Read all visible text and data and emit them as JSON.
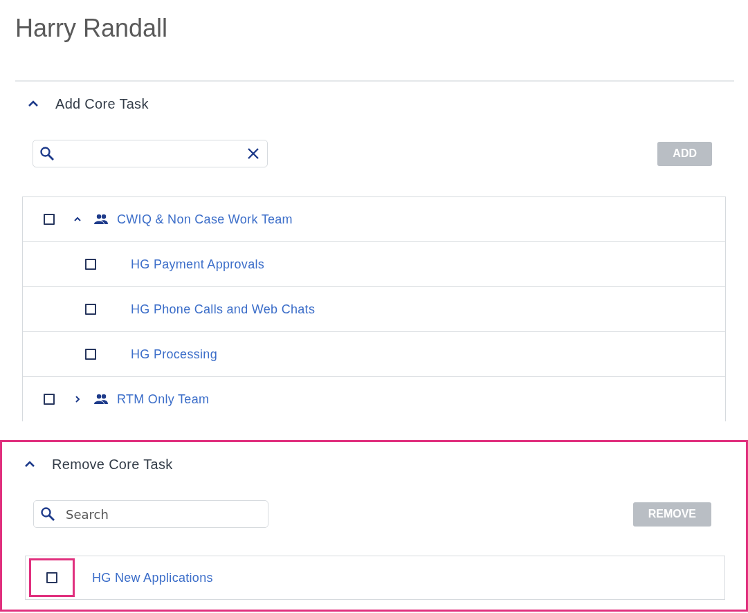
{
  "page": {
    "title": "Harry Randall"
  },
  "sections": [
    {
      "title": "Add Core Task",
      "expanded": true,
      "highlighted": false,
      "search": {
        "clearable": true
      },
      "action": {
        "label": "ADD",
        "disabled": true
      },
      "items": [
        {
          "kind": "group",
          "label": "CWIQ & Non Case Work Team",
          "checked": false,
          "expanded": true,
          "highlighted": false,
          "children": [
            {
              "kind": "task",
              "label": "HG Payment Approvals",
              "checked": false,
              "highlighted": false
            },
            {
              "kind": "task",
              "label": "HG Phone Calls and Web Chats",
              "checked": false,
              "highlighted": false
            },
            {
              "kind": "task",
              "label": "HG Processing",
              "checked": false,
              "highlighted": false
            }
          ]
        },
        {
          "kind": "group",
          "label": "RTM Only Team",
          "checked": false,
          "expanded": false,
          "highlighted": false
        }
      ]
    },
    {
      "title": "Remove Core Task",
      "expanded": true,
      "highlighted": true,
      "search": {
        "placeholder": "Search",
        "clearable": false
      },
      "action": {
        "label": "REMOVE",
        "disabled": true
      },
      "items": [
        {
          "kind": "task",
          "label": "HG New Applications",
          "checked": false,
          "highlighted": true
        }
      ]
    }
  ]
}
